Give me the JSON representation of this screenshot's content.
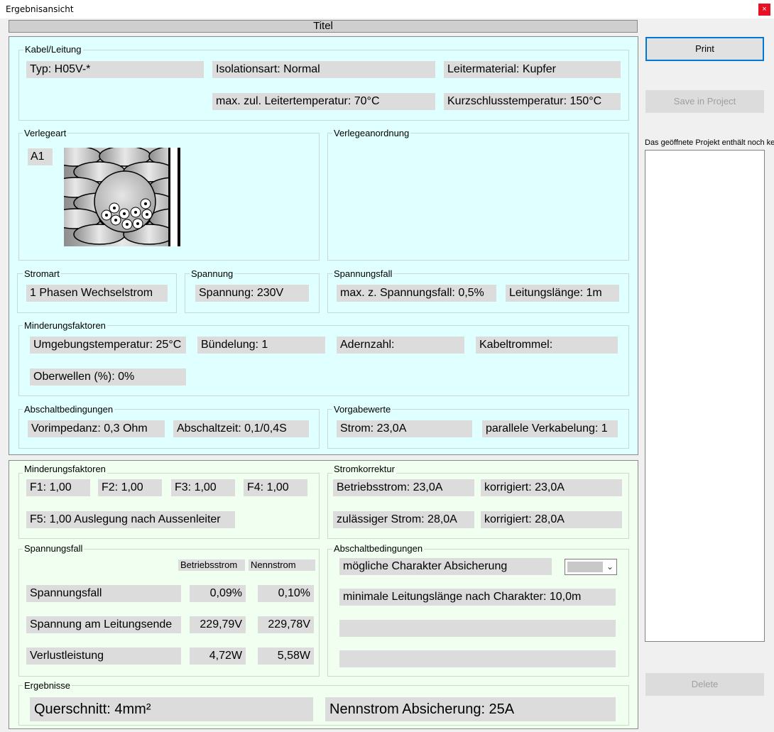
{
  "window": {
    "title": "Ergebnisansicht",
    "close_label": "×"
  },
  "header": {
    "titel": "Titel"
  },
  "kabel": {
    "label": "Kabel/Leitung",
    "typ": "Typ: H05V-*",
    "isolationsart": "Isolationsart: Normal",
    "leitermaterial": "Leitermaterial: Kupfer",
    "max_temp": "max. zul. Leitertemperatur: 70°C",
    "kurzschluss": "Kurzschlusstemperatur: 150°C"
  },
  "verlegeart": {
    "label": "Verlegeart",
    "code": "A1"
  },
  "verlegeanordnung": {
    "label": "Verlegeanordnung"
  },
  "stromart": {
    "label": "Stromart",
    "value": "1 Phasen Wechselstrom"
  },
  "spannung": {
    "label": "Spannung",
    "value": "Spannung: 230V"
  },
  "spannungsfall_in": {
    "label": "Spannungsfall",
    "max": "max. z. Spannungsfall: 0,5%",
    "laenge": "Leitungslänge: 1m"
  },
  "minderung_in": {
    "label": "Minderungsfaktoren",
    "umgebung": "Umgebungstemperatur: 25°C",
    "buendelung": "Bündelung: 1",
    "adernzahl": "Adernzahl:",
    "kabeltrommel": "Kabeltrommel:",
    "oberwellen": "Oberwellen (%): 0%"
  },
  "abschalt_in": {
    "label": "Abschaltbedingungen",
    "vorimpedanz": "Vorimpedanz: 0,3 Ohm",
    "abschaltzeit": "Abschaltzeit: 0,1/0,4S"
  },
  "vorgabe": {
    "label": "Vorgabewerte",
    "strom": "Strom:  23,0A",
    "parallel": "parallele Verkabelung: 1"
  },
  "minderung_out": {
    "label": "Minderungsfaktoren",
    "f1": "F1:  1,00",
    "f2": "F2:  1,00",
    "f3": "F3:  1,00",
    "f4": "F4:  1,00",
    "f5": "F5:  1,00  Auslegung nach Aussenleiter"
  },
  "stromkorrektur": {
    "label": "Stromkorrektur",
    "betriebsstrom": "Betriebsstrom:  23,0A",
    "korr1": "korrigiert:  23,0A",
    "zulaessig": "zulässiger Strom:  28,0A",
    "korr2": "korrigiert:  28,0A"
  },
  "spannungsfall_out": {
    "label": "Spannungsfall",
    "col_betrieb": "Betriebsstrom",
    "col_nenn": "Nennstrom",
    "rows": [
      {
        "label": "Spannungsfall",
        "betrieb": "0,09%",
        "nenn": "0,10%"
      },
      {
        "label": "Spannung am Leitungsende",
        "betrieb": "229,79V",
        "nenn": "229,78V"
      },
      {
        "label": "Verlustleistung",
        "betrieb": "4,72W",
        "nenn": "5,58W"
      }
    ]
  },
  "abschalt_out": {
    "label": "Abschaltbedingungen",
    "charakter": "mögliche Charakter Absicherung",
    "minlaenge": "minimale Leitungslänge nach Charakter:  10,0m",
    "blank1": "",
    "blank2": ""
  },
  "ergebnisse": {
    "label": "Ergebnisse",
    "querschnitt": "Querschnitt: 4mm²",
    "nennstrom": "Nennstrom Absicherung: 25A"
  },
  "side": {
    "print": "Print",
    "save": "Save in Project",
    "info": "Das geöffnete Projekt enthält noch kei",
    "delete": "Delete"
  }
}
